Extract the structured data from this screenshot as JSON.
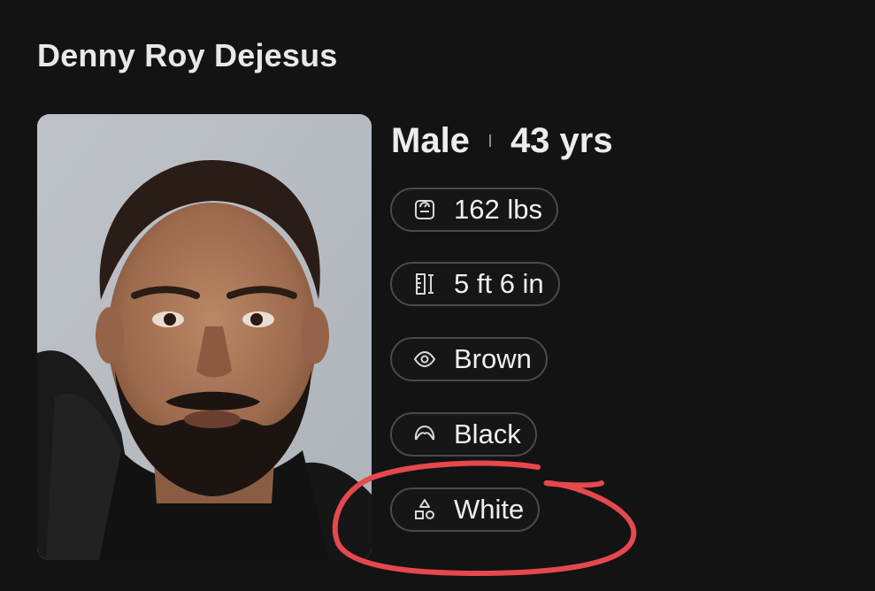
{
  "person": {
    "name": "Denny Roy Dejesus",
    "sex": "Male",
    "age": "43 yrs"
  },
  "attributes": [
    {
      "icon": "scale-icon",
      "value": "162 lbs"
    },
    {
      "icon": "height-ruler-icon",
      "value": "5 ft 6 in"
    },
    {
      "icon": "eye-icon",
      "value": "Brown"
    },
    {
      "icon": "hair-icon",
      "value": "Black"
    },
    {
      "icon": "shapes-icon",
      "value": "White"
    }
  ],
  "colors": {
    "background": "#131313",
    "chip_border": "#4a4a4a",
    "annotation": "#e5484d"
  }
}
